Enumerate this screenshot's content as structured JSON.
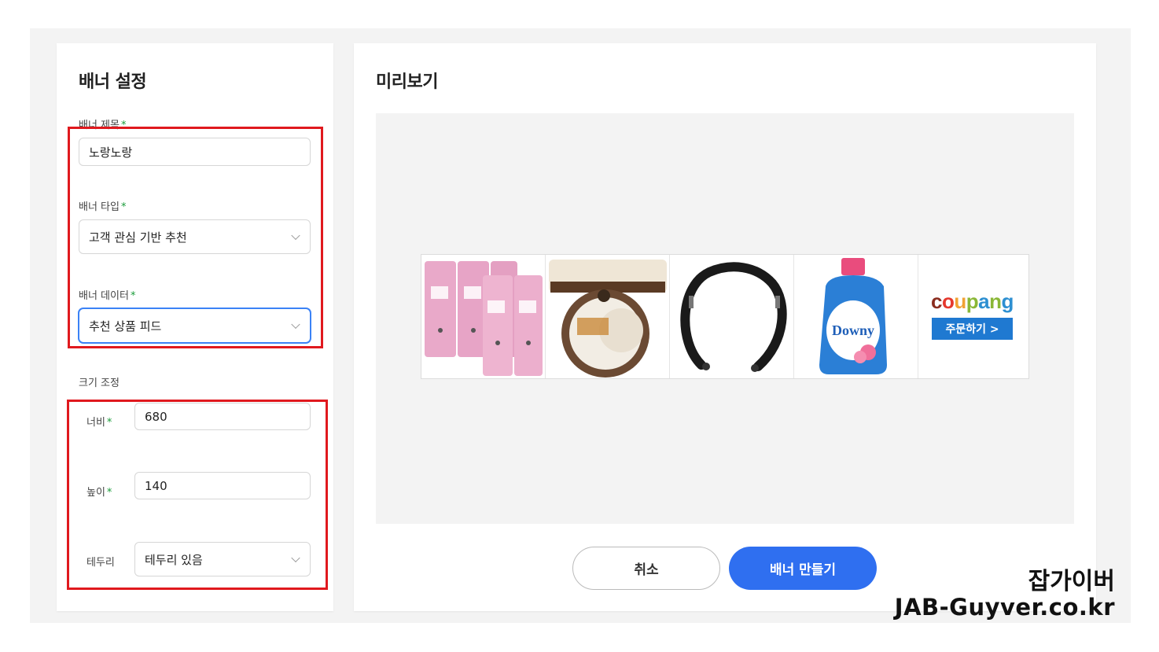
{
  "settings": {
    "title": "배너 설정",
    "banner_title_label": "배너 제목",
    "banner_title_value": "노랑노랑",
    "banner_type_label": "배너 타입",
    "banner_type_value": "고객 관심 기반 추천",
    "banner_data_label": "배너 데이터",
    "banner_data_value": "추천 상품 피드",
    "size_section_label": "크기 조정",
    "width_label": "너비",
    "width_value": "680",
    "height_label": "높이",
    "height_value": "140",
    "border_label": "테두리",
    "border_value": "테두리 있음",
    "required_mark": "*"
  },
  "preview": {
    "title": "미리보기",
    "products": [
      {
        "name": "pink-rubber-gloves",
        "icon": "gloves-product-image"
      },
      {
        "name": "rice-bowl",
        "icon": "rice-product-image"
      },
      {
        "name": "neckband-headphones",
        "icon": "headphones-product-image"
      },
      {
        "name": "downy-softener",
        "icon": "softener-product-image",
        "brand_text": "Downy"
      }
    ],
    "coupang": {
      "logo_parts": [
        "c",
        "o",
        "u",
        "p",
        "a",
        "n",
        "g"
      ],
      "logo_colors": [
        "#8b2d1f",
        "#e5382d",
        "#f1a233",
        "#8ab737",
        "#2d8fd1",
        "#8ab737",
        "#2d8fd1"
      ],
      "order_label": "주문하기 >"
    }
  },
  "actions": {
    "cancel_label": "취소",
    "create_label": "배너 만들기"
  },
  "watermark": {
    "line1": "잡가이버",
    "line2": "JAB-Guyver.co.kr"
  },
  "colors": {
    "primary": "#2f6ff0",
    "highlight": "#e0191e",
    "required": "#1a9c3a"
  }
}
